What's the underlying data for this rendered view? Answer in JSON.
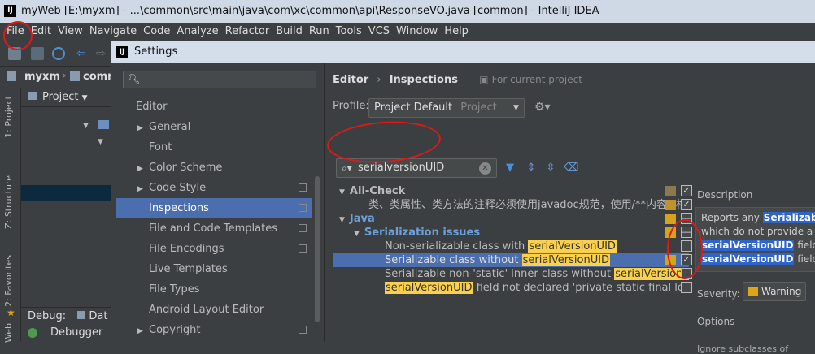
{
  "window": {
    "title": "myWeb [E:\\myxm] - ...\\common\\src\\main\\java\\com\\xc\\common\\api\\ResponseVO.java [common] - IntelliJ IDEA",
    "app_icon": "IJ"
  },
  "menu": [
    "File",
    "Edit",
    "View",
    "Navigate",
    "Code",
    "Analyze",
    "Refactor",
    "Build",
    "Run",
    "Tools",
    "VCS",
    "Window",
    "Help"
  ],
  "breadcrumb": {
    "root": "myxm",
    "child": "comr"
  },
  "project_panel": {
    "label": "Project"
  },
  "left_stripe": {
    "project_tab": "1: Project",
    "structure_tab": "Z: Structure",
    "favorites_tab": "2: Favorites",
    "web_tab": "Web"
  },
  "debug": {
    "label": "Debug:",
    "tab": "Dat",
    "debugger": "Debugger"
  },
  "settings": {
    "title": "Settings",
    "search_placeholder": "",
    "tree": [
      {
        "label": "Editor",
        "level": 0,
        "expandable": false,
        "header": true
      },
      {
        "label": "General",
        "expandable": true
      },
      {
        "label": "Font",
        "expandable": false
      },
      {
        "label": "Color Scheme",
        "expandable": true
      },
      {
        "label": "Code Style",
        "expandable": true,
        "page_icon": true
      },
      {
        "label": "Inspections",
        "expandable": false,
        "page_icon": true,
        "selected": true
      },
      {
        "label": "File and Code Templates",
        "expandable": false,
        "page_icon": true
      },
      {
        "label": "File Encodings",
        "expandable": false,
        "page_icon": true
      },
      {
        "label": "Live Templates",
        "expandable": false
      },
      {
        "label": "File Types",
        "expandable": false
      },
      {
        "label": "Android Layout Editor",
        "expandable": false
      },
      {
        "label": "Copyright",
        "expandable": true,
        "page_icon": true
      }
    ],
    "breadcrumb": {
      "parent": "Editor",
      "sep": "›",
      "current": "Inspections",
      "scope": "For current project"
    },
    "profile": {
      "label": "Profile:",
      "value": "Project Default",
      "scope": "Project"
    },
    "inspection_search": "serialversionUID",
    "inspections": [
      {
        "arrow": "▼",
        "text_before": "Ali-Check",
        "hl": "",
        "text_after": "",
        "bold": true,
        "color": "#bbbbbb",
        "sev_color": "#8b7a50",
        "checked": true,
        "indent": 0
      },
      {
        "arrow": "",
        "text_before": "类、类属性、类方法的注释必须使用javadoc规范，使用/**内容*/格式",
        "hl": "",
        "text_after": "",
        "bold": false,
        "color": "#bbbbbb",
        "sev_color": "#c0922b",
        "checked": true,
        "indent": 36
      },
      {
        "arrow": "▼",
        "text_before": "Java",
        "hl": "",
        "text_after": "",
        "bold": true,
        "color": "#6d9fd8",
        "sev_color": "#d6a31d",
        "checked": "partial",
        "indent": 0
      },
      {
        "arrow": "▼",
        "text_before": "Serialization issues",
        "hl": "",
        "text_after": "",
        "bold": true,
        "color": "#6d9fd8",
        "sev_color": "#d6a31d",
        "checked": "partial",
        "indent": 18
      },
      {
        "arrow": "",
        "text_before": "Non-serializable class with ",
        "hl": "serialVersionUID",
        "text_after": "",
        "bold": false,
        "color": "#bbbbbb",
        "sev_color": "",
        "checked": false,
        "indent": 56
      },
      {
        "arrow": "",
        "text_before": "Serializable class without ",
        "hl": "serialVersionUID",
        "text_after": "",
        "bold": false,
        "color": "#dddddd",
        "sev_color": "#d6a31d",
        "checked": true,
        "indent": 56,
        "selected": true
      },
      {
        "arrow": "",
        "text_before": "Serializable non-'static' inner class without ",
        "hl": "serialVersionUID",
        "text_after": "",
        "bold": false,
        "color": "#bbbbbb",
        "sev_color": "",
        "checked": false,
        "indent": 56
      },
      {
        "arrow": "",
        "text_before": "",
        "hl": "serialVersionUID",
        "text_after": " field not declared 'private static final long'",
        "bold": false,
        "color": "#bbbbbb",
        "sev_color": "",
        "checked": false,
        "indent": 56
      }
    ],
    "description": {
      "header": "Description",
      "line1": "Reports any ",
      "line1_bold": "Serializable",
      "line2": "which do not provide a",
      "line3_bold": "serialVersionUID",
      "line3": " field.",
      "line4_bold": "serialVersionUID",
      "line4": " field, "
    },
    "severity": {
      "label": "Severity:",
      "value": "Warning"
    },
    "options": {
      "header": "Options",
      "ignore": "Ignore subclasses of"
    }
  },
  "colors": {
    "accent_selection": "#4b6eaf",
    "highlight": "#fbd04a",
    "annotation": "#e01818",
    "warning": "#e0a414"
  }
}
